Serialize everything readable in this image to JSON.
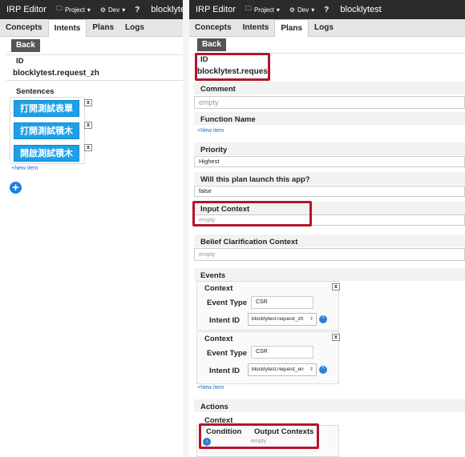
{
  "left": {
    "topbar": {
      "brand": "IRP Editor",
      "project_menu": "Project",
      "dev_menu": "Dev",
      "help": "?",
      "project_name": "blocklytest"
    },
    "tabs": [
      "Concepts",
      "Intents",
      "Plans",
      "Logs"
    ],
    "back_label": "Back",
    "id_label": "ID",
    "id_value": "blocklytest.request_zh",
    "sentences_label": "Sentences",
    "sentences": [
      "打開測試表單",
      "打開測試積木",
      "開啟測試積木"
    ],
    "remove_label": "x",
    "new_item": "+New item",
    "add_icon": "+"
  },
  "right": {
    "topbar": {
      "brand": "IRP Editor",
      "project_menu": "Project",
      "dev_menu": "Dev",
      "help": "?",
      "project_name": "blocklytest"
    },
    "tabs": [
      "Concepts",
      "Intents",
      "Plans",
      "Logs"
    ],
    "back_label": "Back",
    "id_label": "ID",
    "id_value": "blocklytest.request",
    "comment_label": "Comment",
    "comment_value": "empty",
    "function_label": "Function Name",
    "new_item": "+New item",
    "priority_label": "Priority",
    "priority_value": "Highest",
    "launch_label": "Will this plan launch this app?",
    "launch_value": "false",
    "input_context_label": "Input Context",
    "input_context_value": "empty",
    "belief_label": "Belief Clarification Context",
    "belief_value": "empty",
    "events_label": "Events",
    "context_label": "Context",
    "remove_label": "x",
    "event_type_label": "Event Type",
    "intent_id_label": "Intent ID",
    "events": [
      {
        "event_type": "CSR",
        "intent_id": "blocklytest.request_zh"
      },
      {
        "event_type": "CSR",
        "intent_id": "blocklytest.request_en"
      }
    ],
    "actions_label": "Actions",
    "condition_label": "Condition",
    "output_contexts_label": "Output Contexts",
    "output_value": "empty"
  },
  "colors": {
    "topbar": "#2b2b2b",
    "sentence_button": "#1ea0e8",
    "highlight": "#b3162a",
    "link": "#1a6dd6"
  }
}
